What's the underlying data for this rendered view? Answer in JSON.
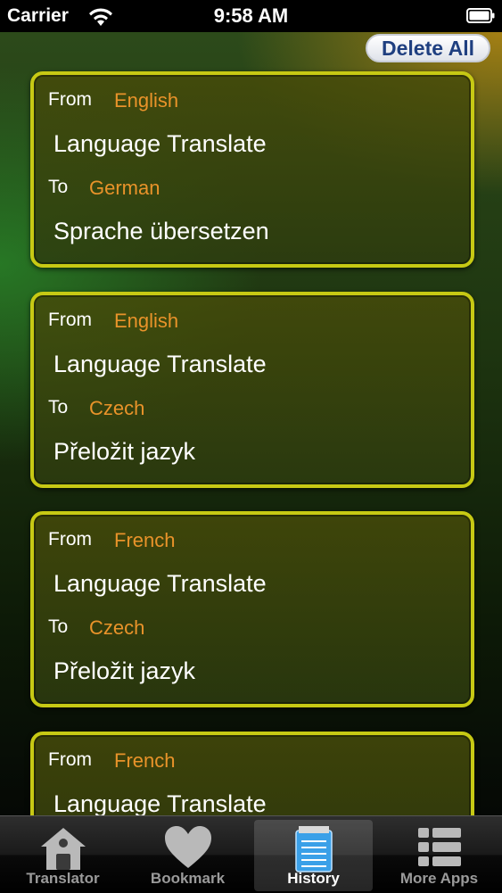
{
  "status_bar": {
    "carrier": "Carrier",
    "time": "9:58 AM"
  },
  "toolbar": {
    "delete_all_label": "Delete All"
  },
  "history": [
    {
      "from_label": "From",
      "from_lang": "English",
      "source": "Language Translate",
      "to_label": "To",
      "to_lang": "German",
      "target": "Sprache übersetzen"
    },
    {
      "from_label": "From",
      "from_lang": "English",
      "source": "Language Translate",
      "to_label": "To",
      "to_lang": "Czech",
      "target": "Přeložit jazyk"
    },
    {
      "from_label": "From",
      "from_lang": "French",
      "source": "Language Translate",
      "to_label": "To",
      "to_lang": "Czech",
      "target": "Přeložit jazyk"
    },
    {
      "from_label": "From",
      "from_lang": "French",
      "source": "Language Translate",
      "to_label": "",
      "to_lang": "",
      "target": ""
    }
  ],
  "tabs": [
    {
      "label": "Translator",
      "icon": "house-icon",
      "selected": false
    },
    {
      "label": "Bookmark",
      "icon": "heart-icon",
      "selected": false
    },
    {
      "label": "History",
      "icon": "notepad-icon",
      "selected": true
    },
    {
      "label": "More Apps",
      "icon": "list-icon",
      "selected": false
    }
  ],
  "colors": {
    "accent_border": "#c7c914",
    "language_text": "#e9932a",
    "delete_button_text": "#1f3f80"
  }
}
